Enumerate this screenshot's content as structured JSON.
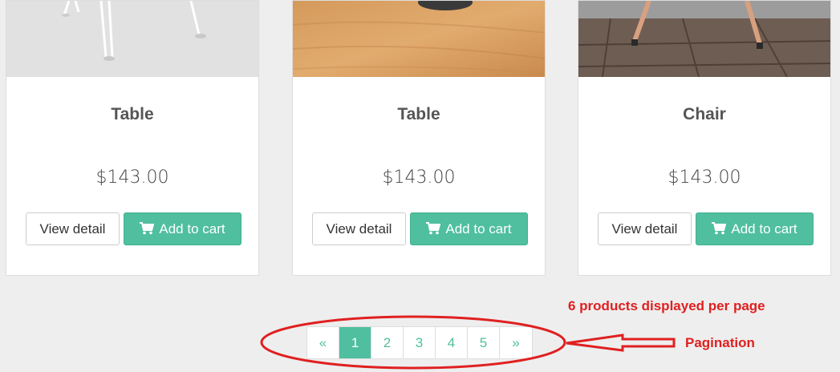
{
  "products": [
    {
      "title": "Table",
      "price": "$143.00",
      "detail_label": "View detail",
      "cart_label": "Add to cart"
    },
    {
      "title": "Table",
      "price": "$143.00",
      "detail_label": "View detail",
      "cart_label": "Add to cart"
    },
    {
      "title": "Chair",
      "price": "$143.00",
      "detail_label": "View detail",
      "cart_label": "Add to cart"
    }
  ],
  "pagination": {
    "prev": "«",
    "pages": [
      "1",
      "2",
      "3",
      "4",
      "5"
    ],
    "active_page": "1",
    "next": "»"
  },
  "annotations": {
    "note": "6 products displayed per page",
    "label": "Pagination"
  },
  "colors": {
    "accent": "#4fbf9f",
    "annotation": "#e02020",
    "background": "#eeeeee"
  }
}
